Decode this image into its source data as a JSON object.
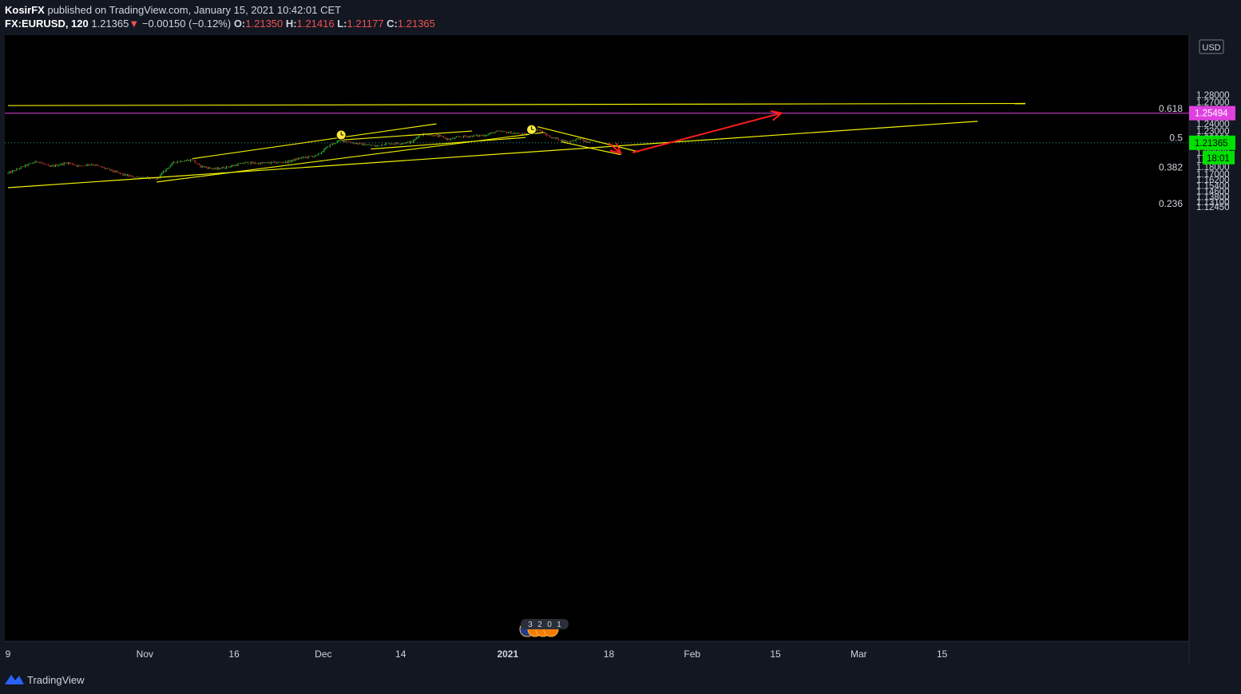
{
  "header": {
    "author": "KosirFX",
    "published": "published on TradingView.com, January 15, 2021 10:42:01 CET",
    "symbol": "FX:EURUSD, 120",
    "last": "1.21365",
    "change_arrow": "▼",
    "change": "−0.00150 (−0.12%)",
    "o_label": "O:",
    "o_value": "1.21350",
    "h_label": "H:",
    "h_value": "1.21416",
    "l_label": "L:",
    "l_value": "1.21177",
    "c_label": "C:",
    "c_value": "1.21365"
  },
  "footer": {
    "brand": "TradingView",
    "logo_icon": "tradingview-logo-icon"
  },
  "chart_data": {
    "type": "candlestick",
    "currency": "USD",
    "x_ticks": [
      "9",
      "Nov",
      "16",
      "Dec",
      "14",
      "2021",
      "18",
      "Feb",
      "15",
      "Mar",
      "15"
    ],
    "y_ticks": [
      "1.28000",
      "1.27000",
      "1.26000",
      "1.25000",
      "1.24000",
      "1.23000",
      "1.22000",
      "1.20000",
      "1.19000",
      "1.18000",
      "1.17000",
      "1.16200",
      "1.15400",
      "1.14600",
      "1.13800",
      "1.13100",
      "1.12450"
    ],
    "fib_levels": [
      {
        "label": "0.618",
        "price": 1.2615
      },
      {
        "label": "0.5",
        "price": 1.2205
      },
      {
        "label": "0.382",
        "price": 1.1795
      },
      {
        "label": "0.236",
        "price": 1.1285
      }
    ],
    "last_price": {
      "label": "1.21365",
      "value": 1.21365,
      "color": "#00e000"
    },
    "countdown": "18:01",
    "target_price": {
      "label": "1.25494",
      "value": 1.25494,
      "color": "#e040e0"
    },
    "event_badges": [
      "3",
      "2",
      "0",
      "1"
    ],
    "price_path": [
      [
        "2020-10-09",
        1.171
      ],
      [
        "2020-10-12",
        1.182
      ],
      [
        "2020-10-14",
        1.188
      ],
      [
        "2020-10-16",
        1.18
      ],
      [
        "2020-10-19",
        1.186
      ],
      [
        "2020-10-21",
        1.181
      ],
      [
        "2020-10-23",
        1.184
      ],
      [
        "2020-10-26",
        1.176
      ],
      [
        "2020-10-28",
        1.17
      ],
      [
        "2020-10-30",
        1.166
      ],
      [
        "2020-11-02",
        1.164
      ],
      [
        "2020-11-03",
        1.163
      ],
      [
        "2020-11-04",
        1.172
      ],
      [
        "2020-11-05",
        1.18
      ],
      [
        "2020-11-06",
        1.187
      ],
      [
        "2020-11-09",
        1.19
      ],
      [
        "2020-11-10",
        1.182
      ],
      [
        "2020-11-12",
        1.178
      ],
      [
        "2020-11-13",
        1.177
      ],
      [
        "2020-11-16",
        1.182
      ],
      [
        "2020-11-18",
        1.186
      ],
      [
        "2020-11-20",
        1.185
      ],
      [
        "2020-11-23",
        1.186
      ],
      [
        "2020-11-25",
        1.187
      ],
      [
        "2020-11-27",
        1.192
      ],
      [
        "2020-11-30",
        1.196
      ],
      [
        "2020-12-01",
        1.203
      ],
      [
        "2020-12-02",
        1.21
      ],
      [
        "2020-12-03",
        1.214
      ],
      [
        "2020-12-04",
        1.217
      ],
      [
        "2020-12-07",
        1.212
      ],
      [
        "2020-12-09",
        1.21
      ],
      [
        "2020-12-10",
        1.209
      ],
      [
        "2020-12-11",
        1.212
      ],
      [
        "2020-12-14",
        1.213
      ],
      [
        "2020-12-16",
        1.215
      ],
      [
        "2020-12-17",
        1.224
      ],
      [
        "2020-12-18",
        1.226
      ],
      [
        "2020-12-21",
        1.222
      ],
      [
        "2020-12-22",
        1.218
      ],
      [
        "2020-12-23",
        1.22
      ],
      [
        "2020-12-24",
        1.222
      ],
      [
        "2020-12-28",
        1.224
      ],
      [
        "2020-12-30",
        1.229
      ],
      [
        "2020-12-31",
        1.229
      ],
      [
        "2021-01-04",
        1.225
      ],
      [
        "2021-01-05",
        1.229
      ],
      [
        "2021-01-06",
        1.233
      ],
      [
        "2021-01-07",
        1.227
      ],
      [
        "2021-01-08",
        1.222
      ],
      [
        "2021-01-11",
        1.215
      ],
      [
        "2021-01-12",
        1.217
      ],
      [
        "2021-01-13",
        1.22
      ],
      [
        "2021-01-14",
        1.215
      ],
      [
        "2021-01-15",
        1.214
      ]
    ],
    "drawings": {
      "color_lines": "#f0f000",
      "color_arrows": "#ff1c1c",
      "lines": [
        {
          "name": "major-support-trendline",
          "from": [
            "2020-10-09",
            1.151
          ],
          "to": [
            "2021-03-21",
            1.2436
          ]
        },
        {
          "name": "upper-resistance-line",
          "from": [
            "2020-10-09",
            1.2655
          ],
          "to": [
            "2021-03-29",
            1.2685
          ]
        },
        {
          "name": "channel1-upper",
          "from": [
            "2020-11-09",
            1.1915
          ],
          "to": [
            "2020-12-20",
            1.24
          ]
        },
        {
          "name": "channel1-lower",
          "from": [
            "2020-11-03",
            1.159
          ],
          "to": [
            "2021-01-07",
            1.228
          ]
        },
        {
          "name": "channel2-upper",
          "from": [
            "2020-12-04",
            1.2175
          ],
          "to": [
            "2020-12-26",
            1.23
          ]
        },
        {
          "name": "channel2-lower",
          "from": [
            "2020-12-09",
            1.205
          ],
          "to": [
            "2021-01-04",
            1.221
          ]
        },
        {
          "name": "channel3-upper",
          "from": [
            "2021-01-06",
            1.236
          ],
          "to": [
            "2021-01-23",
            1.201
          ]
        },
        {
          "name": "channel3-lower",
          "from": [
            "2021-01-10",
            1.215
          ],
          "to": [
            "2021-01-20",
            1.197
          ]
        }
      ],
      "arrows": [
        {
          "name": "down-arrow",
          "from": [
            "2021-01-18",
            1.213
          ],
          "to": [
            "2021-01-20",
            1.199
          ]
        },
        {
          "name": "up-arrow",
          "from": [
            "2021-01-22",
            1.2
          ],
          "to": [
            "2021-02-16",
            1.255
          ]
        }
      ],
      "alerts": [
        {
          "name": "alarm-icon-1",
          "at": [
            "2020-12-04",
            1.2245
          ]
        },
        {
          "name": "alarm-icon-2",
          "at": [
            "2021-01-05",
            1.232
          ]
        }
      ]
    }
  }
}
